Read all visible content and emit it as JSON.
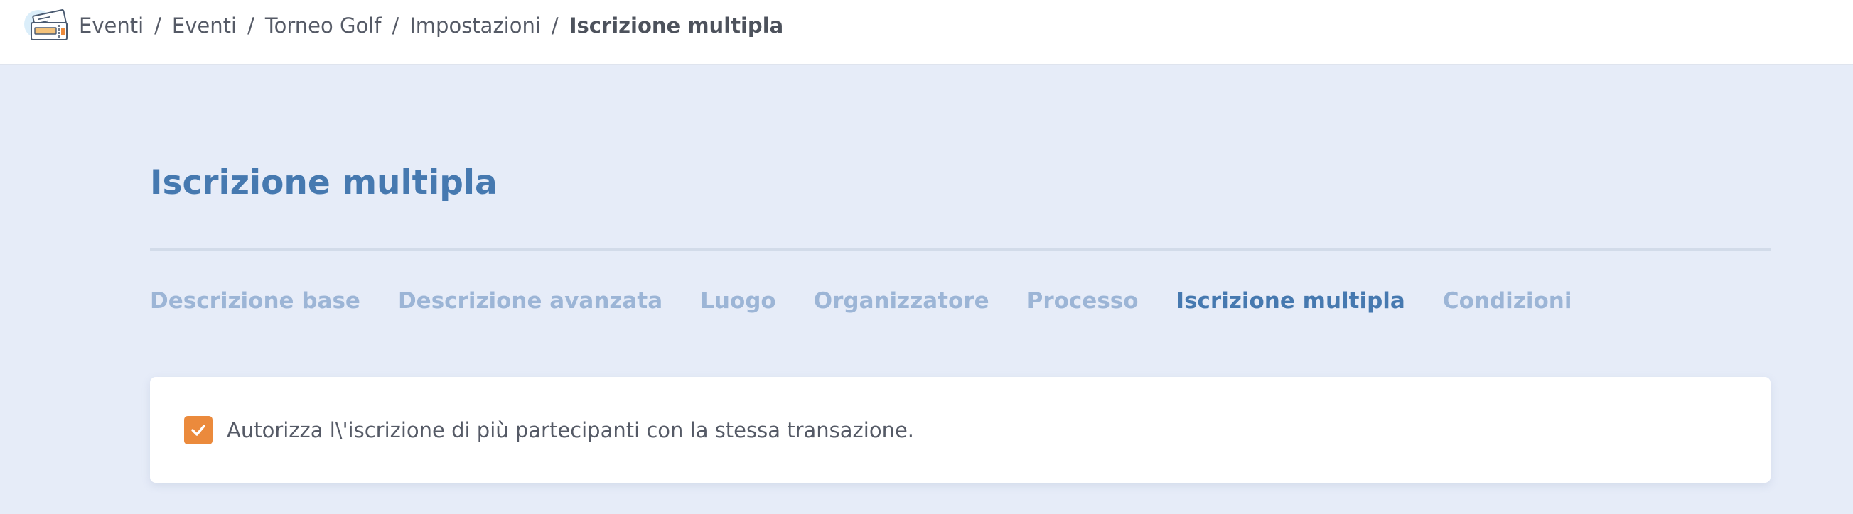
{
  "header": {
    "app_icon": "ticket-icon",
    "breadcrumb": [
      {
        "label": "Eventi"
      },
      {
        "label": "Eventi"
      },
      {
        "label": "Torneo Golf"
      },
      {
        "label": "Impostazioni"
      }
    ],
    "separator": "/",
    "current": "Iscrizione multipla"
  },
  "main": {
    "title": "Iscrizione multipla",
    "tabs": [
      {
        "label": "Descrizione base"
      },
      {
        "label": "Descrizione avanzata"
      },
      {
        "label": "Luogo"
      },
      {
        "label": "Organizzatore"
      },
      {
        "label": "Processo"
      },
      {
        "label": "Iscrizione multipla"
      },
      {
        "label": "Condizioni"
      }
    ],
    "active_tab": "Iscrizione multipla",
    "option": {
      "checked": true,
      "label": "Autorizza l\\'iscrizione di più partecipanti con la stessa transazione."
    }
  },
  "colors": {
    "background": "#e6ecf8",
    "accent": "#4679b0",
    "tab_inactive": "#9cb5d6",
    "checkbox": "#eb8a3c"
  }
}
